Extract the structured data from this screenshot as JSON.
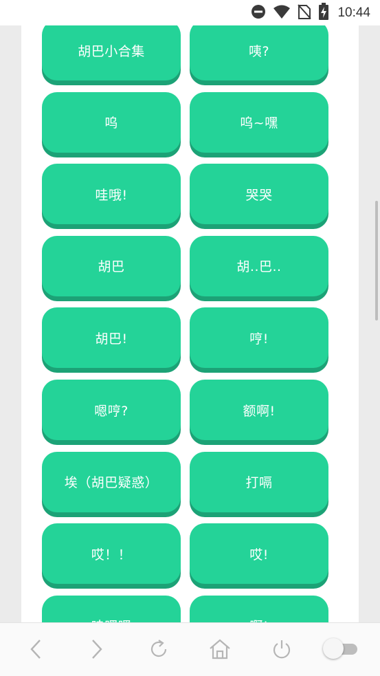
{
  "status_bar": {
    "time": "10:44",
    "icons": [
      "do-not-disturb-icon",
      "wifi-icon",
      "no-sim-icon",
      "battery-charging-icon"
    ]
  },
  "buttons": [
    {
      "label": "胡巴小合集"
    },
    {
      "label": "咦?"
    },
    {
      "label": "呜"
    },
    {
      "label": "呜~嘿"
    },
    {
      "label": "哇哦!"
    },
    {
      "label": "哭哭"
    },
    {
      "label": "胡巴"
    },
    {
      "label": "胡..巴.."
    },
    {
      "label": "胡巴!"
    },
    {
      "label": "哼!"
    },
    {
      "label": "嗯哼?"
    },
    {
      "label": "额啊!"
    },
    {
      "label": "埃（胡巴疑惑）"
    },
    {
      "label": "打嗝"
    },
    {
      "label": "哎！！"
    },
    {
      "label": "哎!"
    },
    {
      "label": "哇嘿嘿"
    },
    {
      "label": "啊!"
    }
  ],
  "bottom_nav": {
    "items": [
      "back-icon",
      "forward-icon",
      "refresh-icon",
      "home-icon",
      "power-icon"
    ],
    "toggle_on": false
  },
  "colors": {
    "button": "#24d398",
    "button_shadow": "#1ca276"
  }
}
